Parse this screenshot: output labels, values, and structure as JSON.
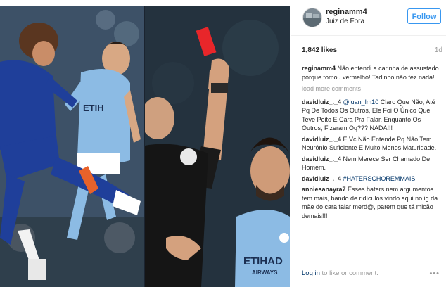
{
  "header": {
    "username": "reginamm4",
    "location": "Juiz de Fora",
    "follow_label": "Follow"
  },
  "stats": {
    "likes": "1,842 likes",
    "time": "1d"
  },
  "caption": {
    "user": "reginamm4",
    "text": "Não entendi a carinha de assustado porque tomou vermelho! Tadinho não fez nada!"
  },
  "load_more_label": "load more comments",
  "comments": [
    {
      "user": "davidluiz_._4",
      "mention": "@luan_lm10",
      "text": " Claro Que Não, Até Pq De Todos Os Outros, Ele Foi O Único Que Teve Peito E Cara Pra Falar, Enquanto Os Outros, Fizeram Oq??? NADA!!!"
    },
    {
      "user": "davidluiz_._4",
      "mention": "",
      "text": "E Vc Não Entende Pq Não Tem Neurônio Suficiente E Muito Menos Maturidade."
    },
    {
      "user": "davidluiz_._4",
      "mention": "",
      "text": "Nem Merece Ser Chamado De Homem."
    },
    {
      "user": "davidluiz_._4",
      "mention": "#HATERSCHOREMMAIS",
      "text": ""
    },
    {
      "user": "anniesanayra7",
      "mention": "",
      "text": "Esses haters nem argumentos tem mais, bando de ridículos vindo aqui no ig da mãe do cara falar merd@, parem que tá micão demais!!!"
    }
  ],
  "footer": {
    "login_label": "Log in",
    "login_suffix": " to like or comment.",
    "more_label": "•••"
  },
  "photo": {
    "left_shirt_number": "",
    "right_sponsor_text": "ETIHAD AIRWAYS",
    "left_sponsor_text": "ETIHAD AIRWAYS",
    "card_color": "#e8262a",
    "chelsea_blue": "#1f3f9a",
    "city_blue": "#8cbbe4"
  }
}
